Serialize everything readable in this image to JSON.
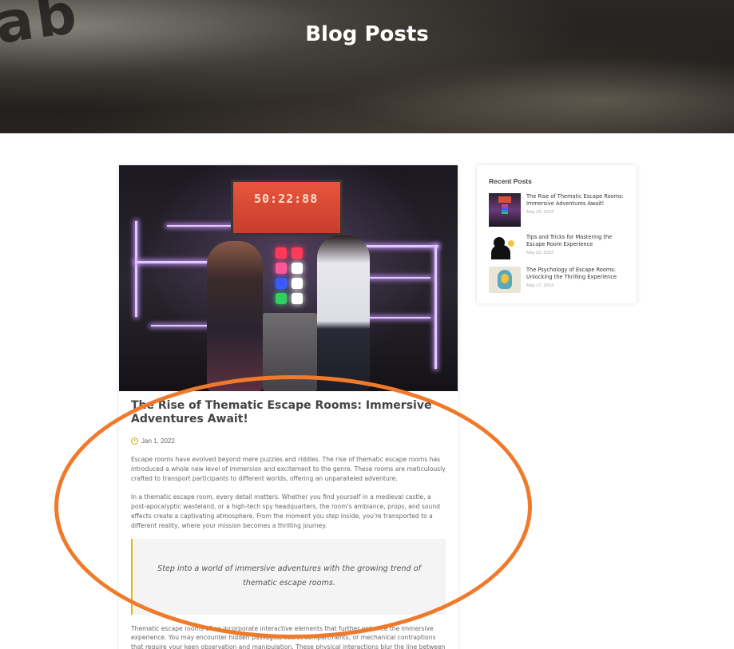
{
  "hero": {
    "title": "Blog Posts"
  },
  "article": {
    "image_alt": "Two players pressing buttons on a neon-lit escape room console",
    "screen_text": "50:22:88",
    "title": "The Rise of Thematic Escape Rooms: Immersive Adventures Await!",
    "date": "Jan 1, 2022",
    "paragraphs": [
      "Escape rooms have evolved beyond mere puzzles and riddles. The rise of thematic escape rooms has introduced a whole new level of immersion and excitement to the genre. These rooms are meticulously crafted to transport participants to different worlds, offering an unparalleled adventure.",
      "In a thematic escape room, every detail matters. Whether you find yourself in a medieval castle, a post-apocalyptic wasteland, or a high-tech spy headquarters, the room's ambiance, props, and sound effects create a captivating atmosphere. From the moment you step inside, you're transported to a different reality, where your mission becomes a thrilling journey."
    ],
    "quote": "Step into a world of immersive adventures with the growing trend of thematic escape rooms.",
    "paragraph_after_quote": "Thematic escape rooms often incorporate interactive elements that further enhance the immersive experience. You may encounter hidden passages, secret compartments, or mechanical contraptions that require your keen observation and manipulation. These physical interactions blur the line between fiction and reality, making the experience all the more memorable."
  },
  "sidebar": {
    "heading": "Recent Posts",
    "posts": [
      {
        "title": "The Rise of Thematic Escape Rooms: Immersive Adventures Await!",
        "date": "May 25, 2023"
      },
      {
        "title": "Tips and Tricks for Mastering the Escape Room Experience",
        "date": "May 22, 2023"
      },
      {
        "title": "The Psychology of Escape Rooms: Unlocking the Thrilling Experience",
        "date": "May 17, 2023"
      }
    ]
  },
  "colors": {
    "accent": "#e6b800",
    "annotation": "#f07a2b",
    "hero_overlay": "#1d1b19"
  }
}
